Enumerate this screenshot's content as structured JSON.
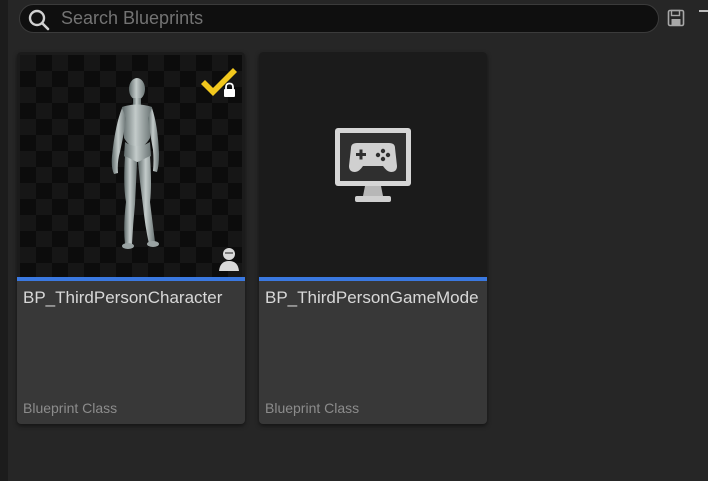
{
  "search": {
    "placeholder": "Search Blueprints",
    "value": ""
  },
  "toolbar": {
    "icons": [
      "search-icon",
      "save-icon",
      "more-options-icon"
    ]
  },
  "cards": [
    {
      "title": "BP_ThirdPersonCharacter",
      "type": "Blueprint Class",
      "thumbnail": "mannequin-figure",
      "badges": [
        "checked-out-icon",
        "lock-icon",
        "person-icon"
      ]
    },
    {
      "title": "BP_ThirdPersonGameMode",
      "type": "Blueprint Class",
      "thumbnail": "game-monitor-icon",
      "badges": []
    }
  ],
  "colors": {
    "background": "#262626",
    "card": "#383838",
    "accent": "#3a78e0",
    "checkmark": "#f2c81d"
  }
}
